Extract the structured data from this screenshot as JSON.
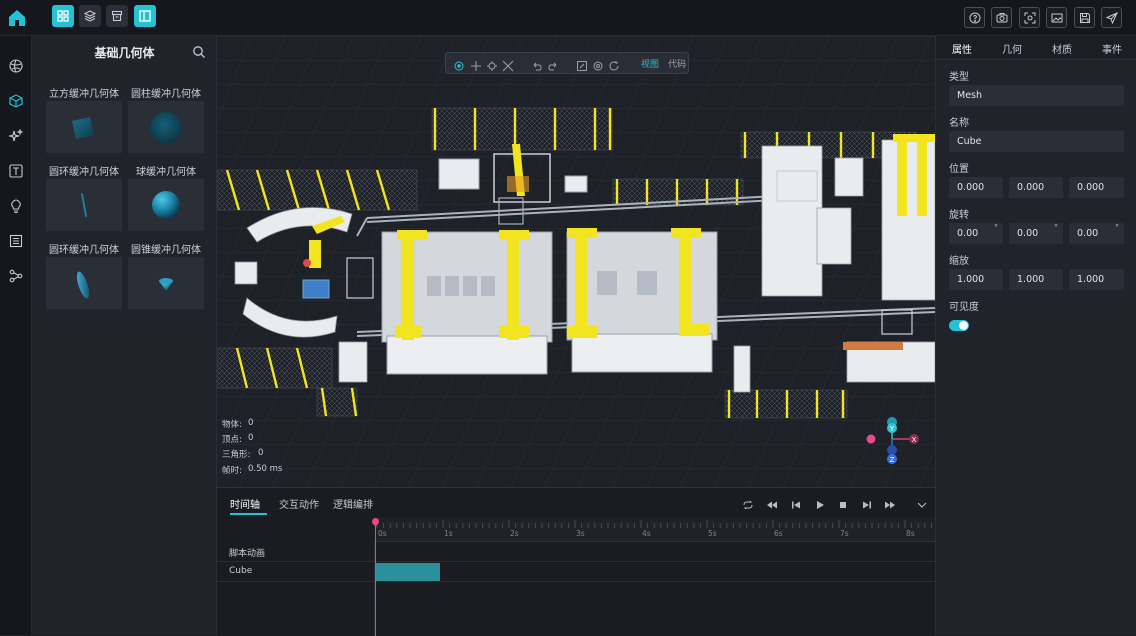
{
  "topbar": {
    "left_tools": [
      "grid-icon",
      "layers-icon",
      "store-icon",
      "panel-icon"
    ],
    "right_tools": [
      "help-icon",
      "camera-icon",
      "capture-icon",
      "screenshot-icon",
      "save-icon",
      "send-icon"
    ],
    "accent": "#25c2d3"
  },
  "rail": {
    "items": [
      "globe-icon",
      "cube-icon",
      "sparkle-icon",
      "text-icon",
      "bulb-icon",
      "list-icon",
      "flow-icon"
    ],
    "active_index": 1
  },
  "library": {
    "title": "基础几何体",
    "items": [
      {
        "label": "立方缓冲几何体",
        "shape": "cube"
      },
      {
        "label": "圆柱缓冲几何体",
        "shape": "cylinder"
      },
      {
        "label": "圆环缓冲几何体",
        "shape": "ring-thin"
      },
      {
        "label": "球缓冲几何体",
        "shape": "sphere"
      },
      {
        "label": "圆环缓冲几何体",
        "shape": "ring"
      },
      {
        "label": "圆锥缓冲几何体",
        "shape": "cone"
      }
    ]
  },
  "viewport": {
    "tabs": [
      "视图",
      "代码"
    ],
    "active_tab": 0,
    "stats": [
      {
        "label": "物体:",
        "value": "0"
      },
      {
        "label": "顶点:",
        "value": "0"
      },
      {
        "label": "三角形:",
        "value": "0"
      },
      {
        "label": "帧时:",
        "value": "0.50 ms"
      }
    ],
    "gizmo": {
      "y": "Y",
      "x": "X",
      "z": "Z"
    }
  },
  "timeline": {
    "tabs": [
      "时间轴",
      "交互动作",
      "逻辑编排"
    ],
    "active_tab": 0,
    "ticks": [
      "0s",
      "1s",
      "2s",
      "3s",
      "4s",
      "5s",
      "6s",
      "7s",
      "8s"
    ],
    "tracks": [
      "脚本动画",
      "Cube"
    ]
  },
  "properties": {
    "tabs": [
      "属性",
      "几何",
      "材质",
      "事件"
    ],
    "active_tab": 0,
    "type_label": "类型",
    "type_value": "Mesh",
    "name_label": "名称",
    "name_value": "Cube",
    "position_label": "位置",
    "position": [
      "0.000",
      "0.000",
      "0.000"
    ],
    "rotation_label": "旋转",
    "rotation": [
      "0.00",
      "0.00",
      "0.00"
    ],
    "degree": "°",
    "scale_label": "缩放",
    "scale": [
      "1.000",
      "1.000",
      "1.000"
    ],
    "visible_label": "可见度",
    "visible": true
  }
}
